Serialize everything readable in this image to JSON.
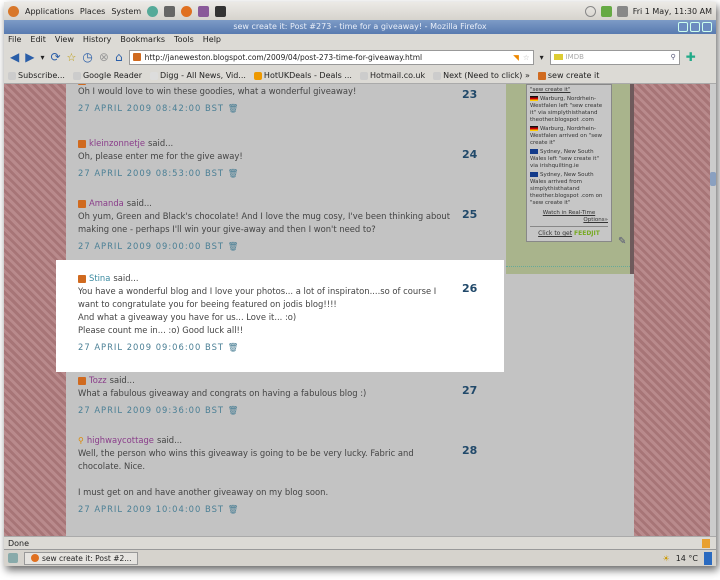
{
  "panel": {
    "applications": "Applications",
    "places": "Places",
    "system": "System",
    "clock": "Fri  1 May, 11:30 AM"
  },
  "window": {
    "title": "sew create it: Post #273 - time for a giveaway! - Mozilla Firefox"
  },
  "menu": [
    "File",
    "Edit",
    "View",
    "History",
    "Bookmarks",
    "Tools",
    "Help"
  ],
  "nav": {
    "url": "http://janeweston.blogspot.com/2009/04/post-273-time-for-giveaway.html",
    "search_placeholder": "IMDB"
  },
  "bookmarks": [
    "Subscribe...",
    "Google Reader",
    "Digg - All News, Vid...",
    "HotUKDeals - Deals ...",
    "Hotmail.co.uk",
    "Next (Need to click) »",
    "sew create it"
  ],
  "comments": [
    {
      "author": "",
      "said": "",
      "text": [
        "Oh I would love to win these goodies, what a wonderful giveaway!"
      ],
      "date": "27 APRIL 2009 08:42:00 BST",
      "num": "23"
    },
    {
      "author": "kleinzonnetje",
      "said": "said...",
      "text": [
        "Oh, please enter me for the give away!"
      ],
      "date": "27 APRIL 2009 08:53:00 BST",
      "num": "24"
    },
    {
      "author": "Amanda",
      "said": "said...",
      "text": [
        "Oh yum, Green and Black's chocolate! And I love the mug cosy, I've been thinking about making one - perhaps I'll win your give-away and then I won't need to?"
      ],
      "date": "27 APRIL 2009 09:00:00 BST",
      "num": "25"
    },
    {
      "author": "Stina",
      "said": "said...",
      "text": [
        "You have a wonderful blog and I love your photos... a lot of inspiraton....so of course I want to congratulate you for beeing featured on jodis blog!!!!",
        "And what a giveaway you have for us... Love it... :o)",
        "Please count me in... :o) Good luck all!!"
      ],
      "date": "27 APRIL 2009 09:06:00 BST",
      "num": "26"
    },
    {
      "author": "Tozz",
      "said": "said...",
      "text": [
        "What a fabulous giveaway and congrats on having a fabulous blog :)"
      ],
      "date": "27 APRIL 2009 09:36:00 BST",
      "num": "27"
    },
    {
      "author": "highwaycottage",
      "said": "said...",
      "text": [
        "Well, the person who wins this giveaway is going to be be very lucky. Fabric and chocolate. Nice.",
        "",
        "I must get on and have another giveaway on my blog soon."
      ],
      "date": "27 APRIL 2009 10:04:00 BST",
      "num": "28"
    }
  ],
  "feedjit": {
    "top": "\"sew create it\"",
    "entries": [
      {
        "text": "Warburg, Nordrhein-Westfalen left \"sew create it\" via simplythisthatand theother.blogspot .com"
      },
      {
        "text": "Warburg, Nordrhein-Westfalen arrived on \"sew create it\""
      },
      {
        "text": "Sydney, New South Wales left \"sew create it\" via irishquilting.ie"
      },
      {
        "text": "Sydney, New South Wales arrived from simplythisthatand theother.blogspot .com on \"sew create it\""
      }
    ],
    "watch": "Watch in Real-Time",
    "options": "Options»",
    "click": "Click to get",
    "brand": "FEEDJIT"
  },
  "status": "Done",
  "taskbar": {
    "item": "sew create it: Post #2...",
    "weather": "14 °C"
  }
}
